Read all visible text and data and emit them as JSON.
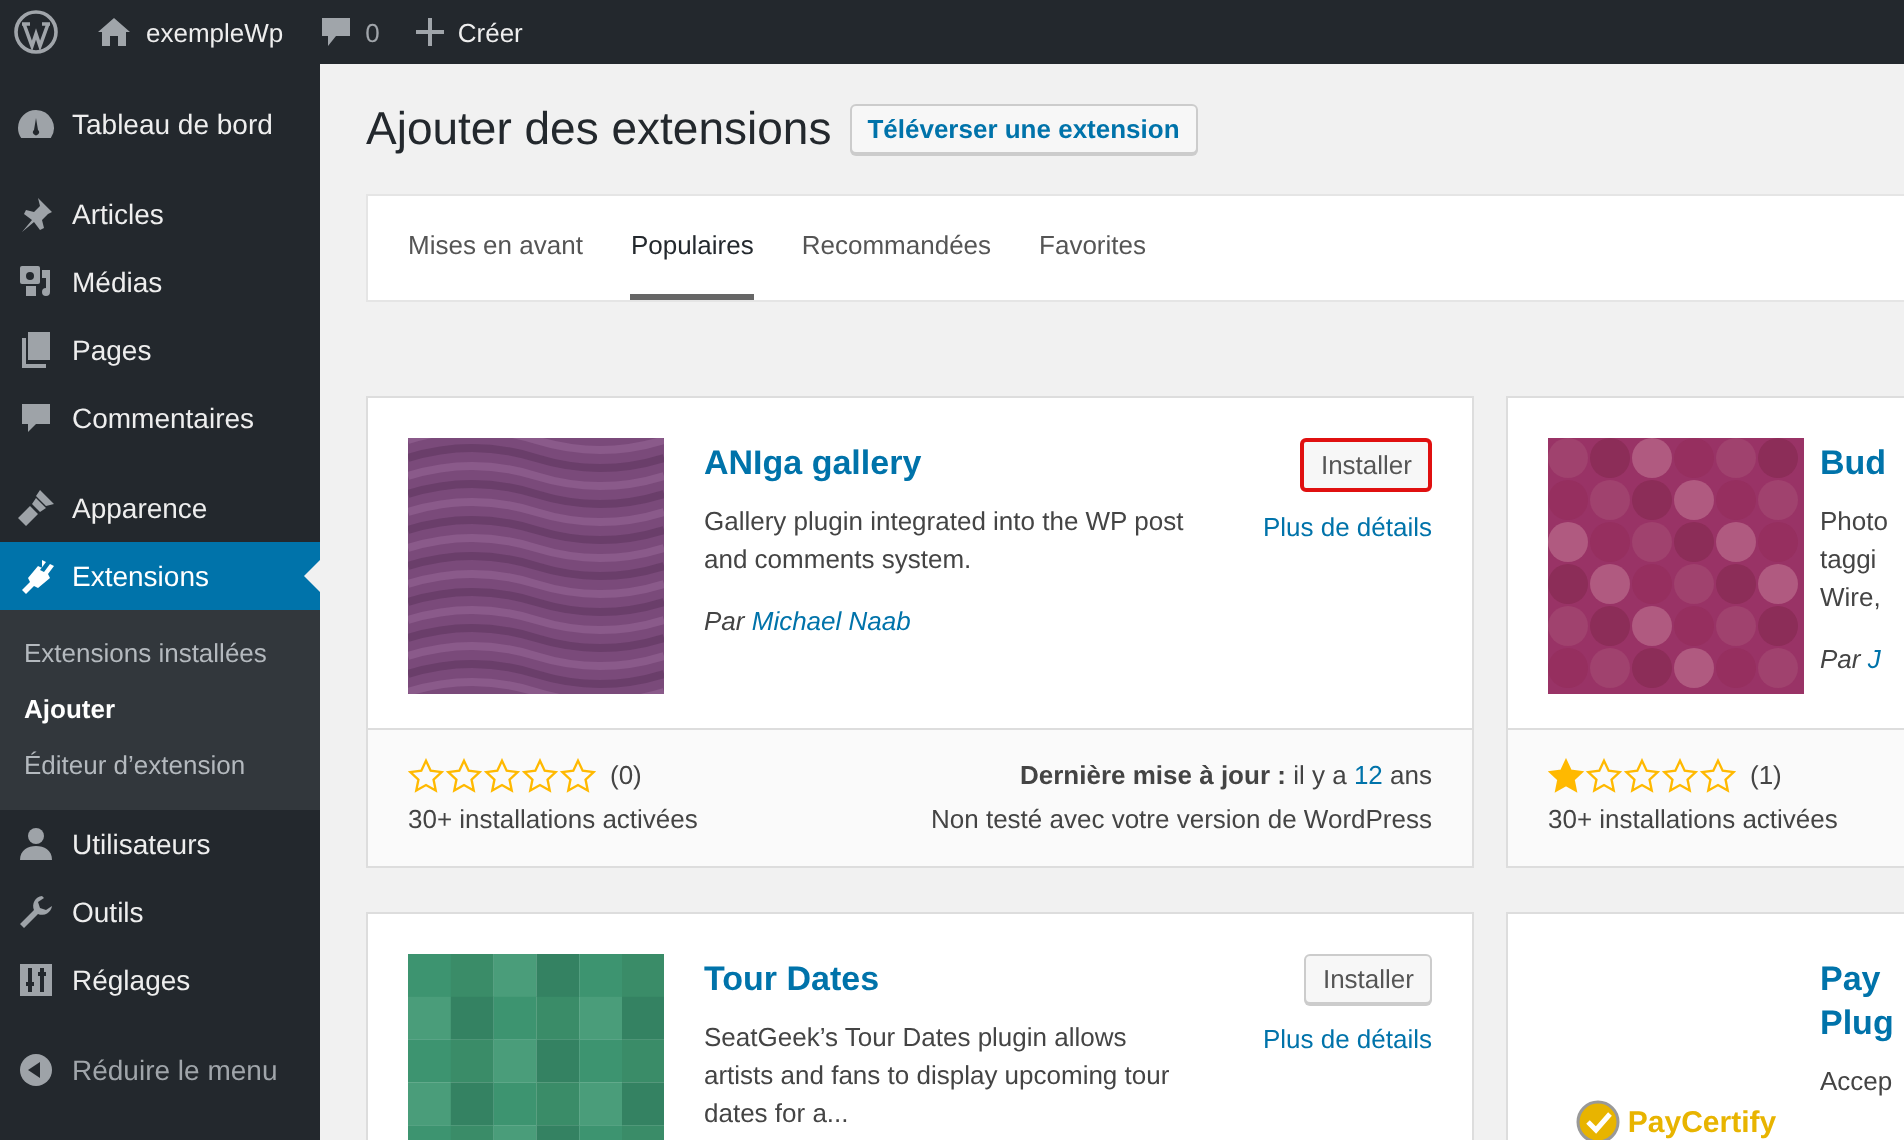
{
  "admin_bar": {
    "site_name": "exempleWp",
    "comments_count": "0",
    "new_label": "Créer"
  },
  "sidebar": {
    "groups": [
      [
        {
          "label": "Tableau de bord",
          "selected": false
        }
      ],
      [
        {
          "label": "Articles",
          "selected": false
        },
        {
          "label": "Médias",
          "selected": false
        },
        {
          "label": "Pages",
          "selected": false
        },
        {
          "label": "Commentaires",
          "selected": false
        }
      ],
      [
        {
          "label": "Apparence",
          "selected": false
        },
        {
          "label": "Extensions",
          "selected": true,
          "children": [
            {
              "label": "Extensions installées",
              "selected": false
            },
            {
              "label": "Ajouter",
              "selected": true
            },
            {
              "label": "Éditeur d’extension",
              "selected": false
            }
          ]
        },
        {
          "label": "Utilisateurs",
          "selected": false
        },
        {
          "label": "Outils",
          "selected": false
        },
        {
          "label": "Réglages",
          "selected": false
        }
      ]
    ],
    "collapse_label": "Réduire le menu"
  },
  "page": {
    "title": "Ajouter des extensions",
    "upload_button": "Téléverser une extension"
  },
  "tabs": [
    {
      "label": "Mises en avant",
      "selected": false
    },
    {
      "label": "Populaires",
      "selected": true
    },
    {
      "label": "Recommandées",
      "selected": false
    },
    {
      "label": "Favorites",
      "selected": false
    }
  ],
  "plugins": [
    {
      "kind": "waves",
      "title_lines": [
        "ANIga gallery"
      ],
      "install_button": "Installer",
      "highlighted": true,
      "details_link": "Plus de détails",
      "description_lines": [
        "Gallery plugin integrated into the WP post",
        "and comments system."
      ],
      "byline": "Par",
      "author": "Michael Naab",
      "stars": 0,
      "rating_count": "(0)",
      "installs": "30+ installations activées",
      "updated_label": "Dernière mise à jour :",
      "updated_prefix": "il y a",
      "updated_value": "12",
      "updated_suffix": "ans",
      "compatibility": "Non testé avec votre version de WordPress"
    },
    {
      "kind": "octagons",
      "title_lines": [
        "Bud"
      ],
      "description_lines": [
        "Photo",
        "taggi",
        "Wire,"
      ],
      "byline": "Par",
      "author": "J",
      "stars": 1,
      "rating_count": "(1)",
      "installs": "30+ installations activées"
    },
    {
      "kind": "squares",
      "title_lines": [
        "Tour Dates"
      ],
      "install_button": "Installer",
      "highlighted": false,
      "details_link": "Plus de détails",
      "description_lines": [
        "SeatGeek’s Tour Dates plugin allows",
        "artists and fans to display upcoming tour",
        "dates for a..."
      ]
    },
    {
      "kind": "logo",
      "logo_text": "PayCertify",
      "title_lines": [
        "Pay",
        "Plug"
      ],
      "description_lines": [
        "Accep"
      ]
    }
  ]
}
